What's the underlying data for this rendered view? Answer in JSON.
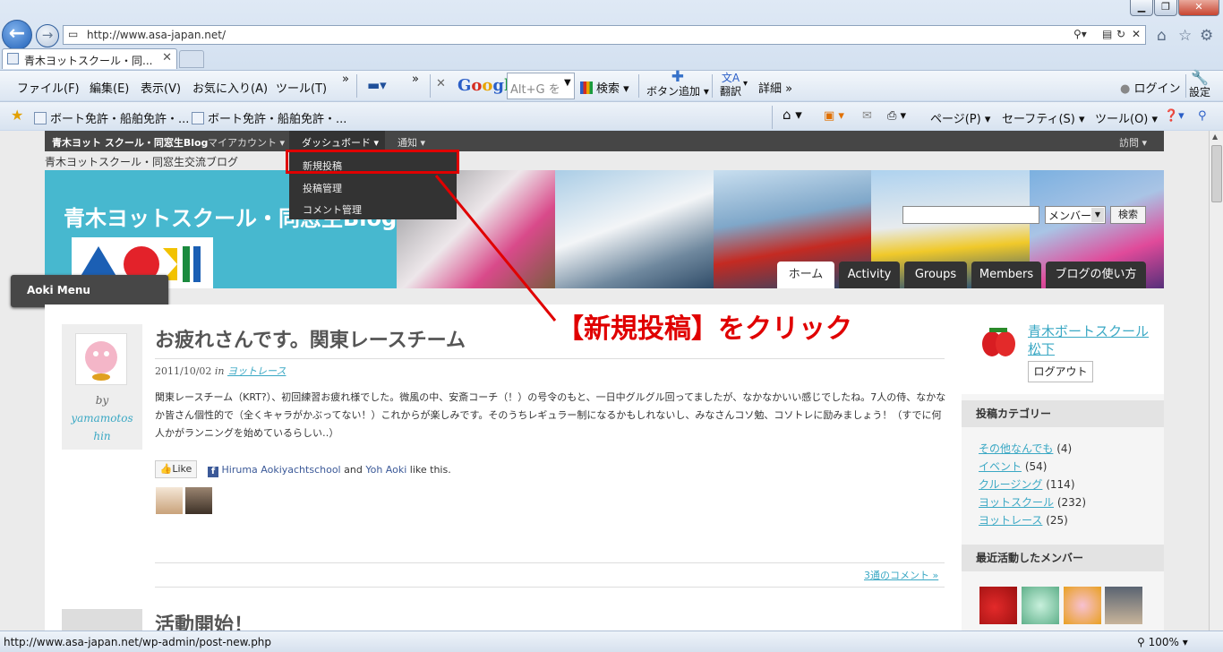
{
  "browser": {
    "url": "http://www.asa-japan.net/",
    "tab_title": "青木ヨットスクール・同...",
    "menus": [
      "ファイル(F)",
      "編集(E)",
      "表示(V)",
      "お気に入り(A)",
      "ツール(T)"
    ],
    "google": {
      "logo": "Google",
      "placeholder": "Alt+G を",
      "search": "検索",
      "add_button": "ボタン追加",
      "translate": "翻訳",
      "details": "詳細 »"
    },
    "login": "ログイン",
    "settings": "設定",
    "favorites": [
      "ボート免許・船舶免許・...",
      "ボート免許・船舶免許・..."
    ],
    "cmd_right": [
      "ページ(P)",
      "セーフティ(S)",
      "ツール(O)"
    ],
    "status_url": "http://www.asa-japan.net/wp-admin/post-new.php",
    "zoom": "100%"
  },
  "adminbar": {
    "site": "青木ヨット スクール・同窓生Blog",
    "my_account": "マイアカウント",
    "dashboard": "ダッシュボード",
    "notify": "通知",
    "visit": "訪問",
    "dropdown": [
      "新規投稿",
      "投稿管理",
      "コメント管理"
    ]
  },
  "site": {
    "tagline": "青木ヨットスクール・同窓生交流ブログ",
    "banner_title": "青木ヨットスクール・同窓生Blog",
    "member_select": "メンバー",
    "search_button": "検索",
    "nav": [
      "ホーム",
      "Activity",
      "Groups",
      "Members",
      "ブログの使い方"
    ],
    "aoki_menu": "Aoki Menu"
  },
  "post": {
    "by": "by",
    "author": "yamamotos hin",
    "title": "お疲れさんです。関東レースチーム",
    "date": "2011/10/02",
    "in": "in",
    "category": "ヨットレース",
    "body": "関東レースチーム（KRT?）、初回練習お疲れ様でした。微風の中、安斎コーチ（！）の号令のもと、一日中グルグル回ってましたが、なかなかいい感じでしたね。7人の侍、なかなか皆さん個性的で（全くキャラがかぶってない！）これからが楽しみです。そのうちレギュラー制になるかもしれないし、みなさんコソ勉、コソトレに励みましょう！（すでに何人かがランニングを始めているらしい‥）",
    "like": "Like",
    "likers": [
      "Hiruma Aokiyachtschool",
      "Yoh Aoki"
    ],
    "like_and": "and",
    "like_suffix": "like this.",
    "comments": "3通のコメント »",
    "next_title": "活動開始！"
  },
  "sidebar": {
    "user_name": "青木ボートスクール松下",
    "logout": "ログアウト",
    "cat_heading": "投稿カテゴリー",
    "categories": [
      {
        "name": "その他なんでも",
        "count": "(4)"
      },
      {
        "name": "イベント",
        "count": "(54)"
      },
      {
        "name": "クルージング",
        "count": "(114)"
      },
      {
        "name": "ヨットスクール",
        "count": "(232)"
      },
      {
        "name": "ヨットレース",
        "count": "(25)"
      }
    ],
    "members_heading": "最近活動したメンバー"
  },
  "annotation": "【新規投稿】をクリック",
  "colors": {
    "accent": "#3aa8c4",
    "annotation": "#e00000",
    "adminbar": "#464646",
    "banner": "#47b8cf"
  }
}
